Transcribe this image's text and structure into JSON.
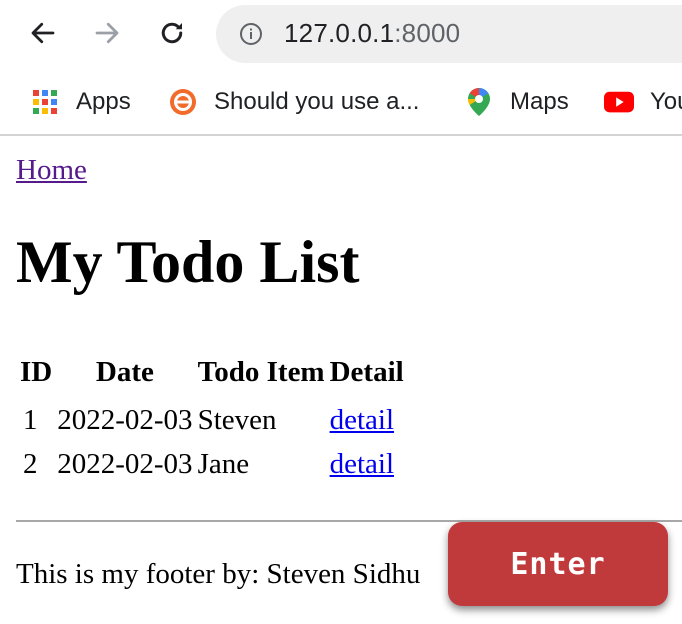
{
  "browser": {
    "url_host": "127.0.0.1",
    "url_port": ":8000",
    "bookmarks": [
      {
        "label": "Apps",
        "icon": "apps-grid-icon"
      },
      {
        "label": "Should you use a...",
        "icon": "target-icon"
      },
      {
        "label": "Maps",
        "icon": "maps-pin-icon"
      },
      {
        "label": "You",
        "icon": "youtube-icon"
      }
    ]
  },
  "page": {
    "home_link": "Home",
    "title": "My Todo List",
    "table": {
      "headers": [
        "ID",
        "Date",
        "Todo Item",
        "Detail"
      ],
      "rows": [
        {
          "id": "1",
          "date": "2022-02-03",
          "item": "Steven",
          "detail": "detail"
        },
        {
          "id": "2",
          "date": "2022-02-03",
          "item": "Jane",
          "detail": "detail"
        }
      ]
    },
    "footer": "This is my footer by: Steven Sidhu",
    "enter_button": "Enter"
  },
  "colors": {
    "enter_button_bg": "#c0393b",
    "visited_link": "#551a8b",
    "link": "#0000ee"
  }
}
